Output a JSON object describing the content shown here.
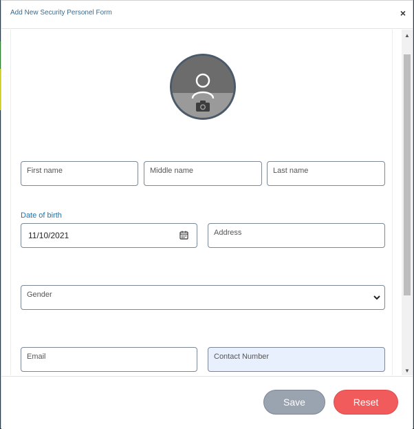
{
  "modal": {
    "title": "Add New Security Personel Form",
    "close_label": "×"
  },
  "form": {
    "first_name_label": "First name",
    "middle_name_label": "Middle name",
    "last_name_label": "Last name",
    "dob_label": "Date of birth",
    "dob_value": "11/10/2021",
    "address_label": "Address",
    "gender_label": "Gender",
    "email_label": "Email",
    "contact_label": "Contact Number"
  },
  "footer": {
    "save_label": "Save",
    "reset_label": "Reset"
  },
  "icons": {
    "avatar": "person-icon",
    "camera": "camera-icon",
    "calendar": "calendar-icon",
    "dropdown": "chevron-down-icon",
    "close": "close-icon"
  },
  "colors": {
    "title": "#3d6a8a",
    "dob_label": "#1f6fa3",
    "save_button": "#9aa3b0",
    "reset_button": "#f25b5b",
    "contact_field_bg": "#e8f0fe"
  }
}
